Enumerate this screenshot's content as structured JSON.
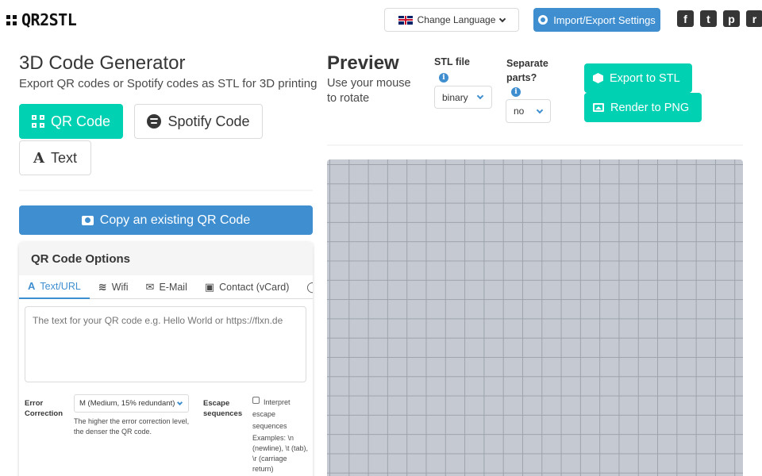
{
  "header": {
    "logo_text": "QR2STL",
    "language_button": "Change Language",
    "import_export_button": "Import/Export Settings",
    "social": [
      {
        "name": "facebook-icon",
        "glyph": "f"
      },
      {
        "name": "twitter-icon",
        "glyph": "t"
      },
      {
        "name": "pinterest-icon",
        "glyph": "p"
      },
      {
        "name": "reddit-icon",
        "glyph": "r"
      }
    ]
  },
  "generator": {
    "title": "3D Code Generator",
    "subtitle": "Export QR codes or Spotify codes as STL for 3D printing",
    "types": {
      "qr": "QR Code",
      "spotify": "Spotify Code",
      "text": "Text"
    },
    "copy_button": "Copy an existing QR Code"
  },
  "qr_options": {
    "heading": "QR Code Options",
    "tabs": {
      "text_url": "Text/URL",
      "wifi": "Wifi",
      "email": "E-Mail",
      "contact": "Contact (vCard)"
    },
    "textarea_placeholder": "The text for your QR code e.g. Hello World or https://flxn.de",
    "error_correction": {
      "label": "Error Correction",
      "selected": "M (Medium, 15% redundant)",
      "help": "The higher the error correction level, the denser the QR code."
    },
    "escape": {
      "label": "Escape sequences",
      "checkbox_label": "Interpret escape sequences",
      "examples": "Examples: \\n (newline), \\t (tab), \\r (carriage return)"
    }
  },
  "preview": {
    "title": "Preview",
    "subtitle": "Use your mouse to rotate",
    "stl_label": "STL file",
    "stl_value": "binary",
    "separate_label": "Separate parts?",
    "separate_value": "no",
    "export_button": "Export to STL",
    "render_button": "Render to PNG"
  },
  "colors": {
    "primary": "#00d1b2",
    "info": "#3e8ed0"
  }
}
